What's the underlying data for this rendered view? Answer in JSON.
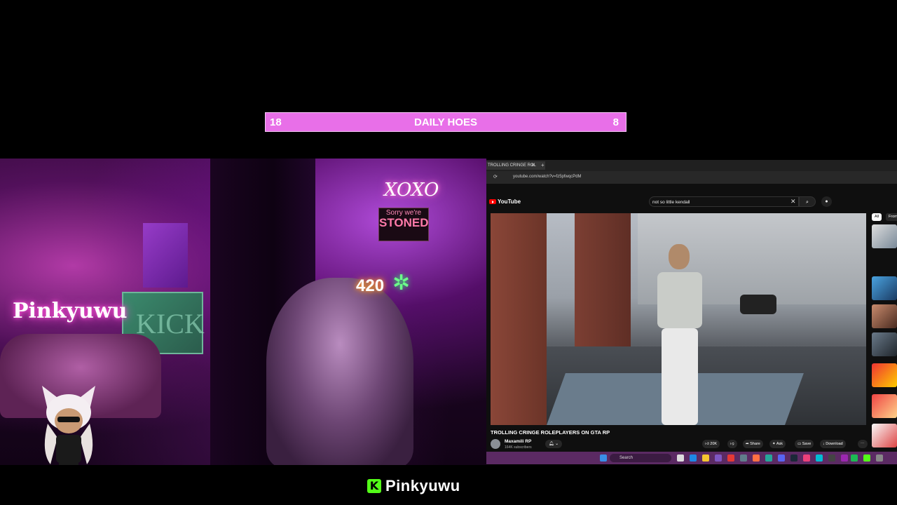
{
  "counter": {
    "left": "18",
    "title": "DAILY HOES",
    "right": "8"
  },
  "webcam": {
    "neon_name": "Pinkyuwu",
    "neon_xoxo": "XOXO",
    "sign_top": "Sorry we're",
    "sign_main": "STONED",
    "neon_420": "420",
    "tv_text": "KICK"
  },
  "browser": {
    "tab_title": "TROLLING CRINGE ROL",
    "tab_close": "✕",
    "new_tab": "+",
    "url": "youtube.com/watch?v=fz5pfwqcPdM"
  },
  "youtube": {
    "logo": "YouTube",
    "search_value": "not so little kendall",
    "search_clear": "✕",
    "video_title": "TROLLING CRINGE ROLEPLAYERS ON GTA RP",
    "channel_name": "Maxamili RP",
    "channel_subs": "164K subscribers",
    "actions": [
      "20K",
      "Share",
      "Ask",
      "Save",
      "Download",
      "⋯"
    ],
    "chips": [
      "All",
      "From"
    ]
  },
  "taskbar": {
    "search_placeholder": "Search"
  },
  "brand": {
    "name": "Pinkyuwu",
    "icon_letter": "K"
  },
  "colors": {
    "counter_bg": "#e86fe8",
    "kick_green": "#53fc18",
    "taskbar": "#5b2a63"
  }
}
